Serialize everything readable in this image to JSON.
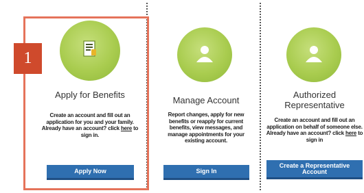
{
  "step_badge": "1",
  "cards": [
    {
      "title": "Apply for Benefits",
      "desc_pre": "Create an account and fill out an application for you and your family. Already have an account? click ",
      "desc_link": "here",
      "desc_post": " to sign in.",
      "button": "Apply Now",
      "icon": "document-icon"
    },
    {
      "title": "Manage Account",
      "desc": "Report changes, apply for new benefits or reapply for current benefits, view messages, and manage appointments for your existing account.",
      "button": "Sign In",
      "icon": "user-icon"
    },
    {
      "title": "Authorized Representative",
      "desc_pre": "Create an account and fill out an application on behalf of someone else. Already have an account? click ",
      "desc_link": "here",
      "desc_post": " to sign in",
      "button": "Create a Representative Account",
      "icon": "user-icon"
    }
  ],
  "colors": {
    "accent_green": "#a9cc4f",
    "button_blue": "#2f6fb0",
    "highlight": "#e5735a",
    "badge": "#cf4a2c"
  }
}
